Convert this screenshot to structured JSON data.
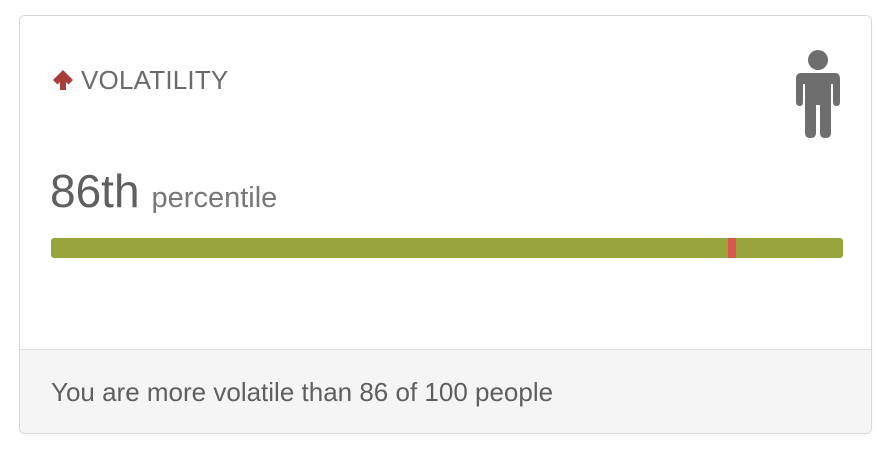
{
  "card": {
    "title": "VOLATILITY",
    "trend_icon": "arrow-up-icon",
    "person_icon": "person-icon",
    "percentile_value": "86th",
    "percentile_unit": "percentile",
    "percentile": 86,
    "footer_text": "You are more volatile than 86 of 100 people"
  },
  "colors": {
    "arrow": "#a83e3b",
    "bar": "#98a43c",
    "marker": "#d9574f",
    "person": "#6e6e6e"
  }
}
